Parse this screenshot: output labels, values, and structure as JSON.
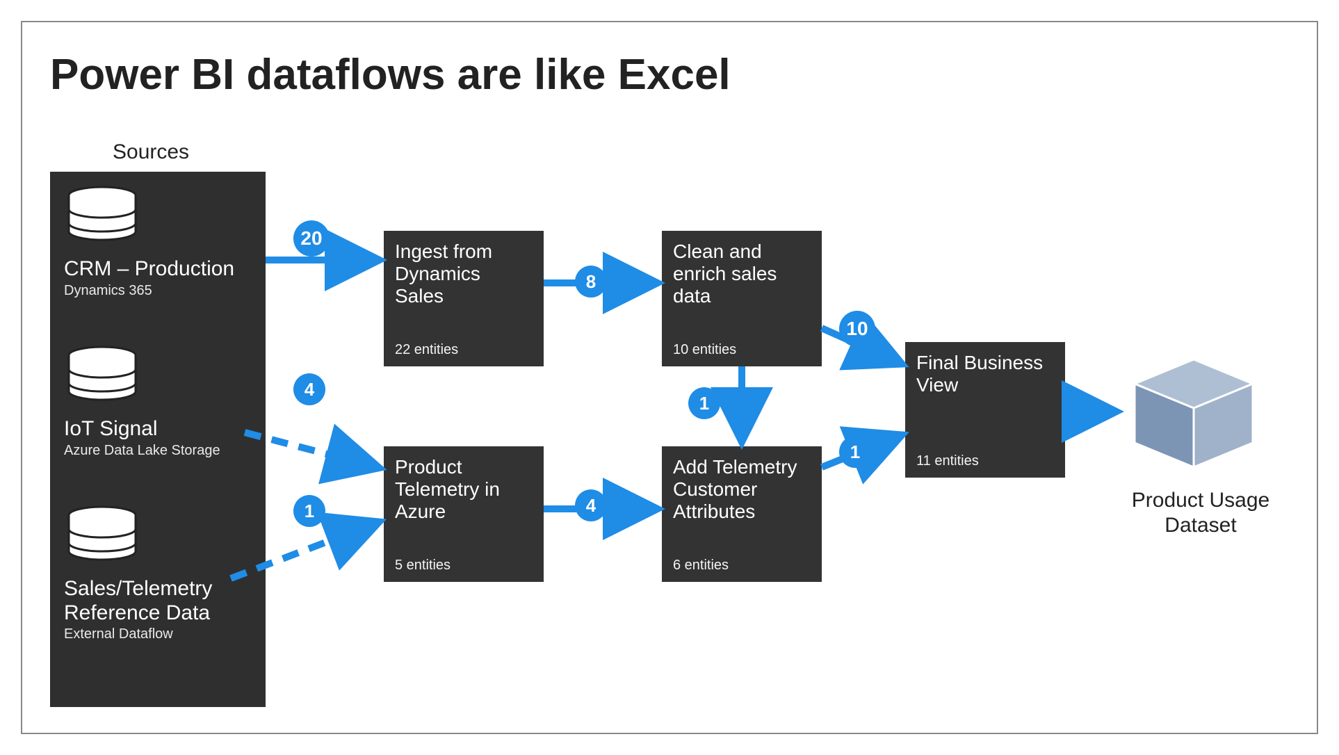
{
  "title": "Power BI dataflows are like Excel",
  "sources_label": "Sources",
  "accent": "#1f8ce6",
  "sources": [
    {
      "name": "CRM – Production",
      "sub": "Dynamics 365"
    },
    {
      "name": "IoT Signal",
      "sub": "Azure Data Lake Storage"
    },
    {
      "name": "Sales/Telemetry Reference Data",
      "sub": "External Dataflow"
    }
  ],
  "nodes": {
    "ingest": {
      "title": "Ingest from Dynamics Sales",
      "sub": "22 entities"
    },
    "clean": {
      "title": "Clean and enrich sales data",
      "sub": "10 entities"
    },
    "telem": {
      "title": "Product Telemetry in Azure",
      "sub": "5 entities"
    },
    "addattr": {
      "title": "Add Telemetry Customer Attributes",
      "sub": "6 entities"
    },
    "final": {
      "title": "Final Business View",
      "sub": "11 entities"
    }
  },
  "edges": {
    "src_crm_to_ingest": "20",
    "ingest_to_clean": "8",
    "src_iot_to_telem": "4",
    "src_ref_to_telem": "1",
    "telem_to_addattr": "4",
    "clean_to_addattr": "1",
    "clean_to_final": "10",
    "addattr_to_final": "1"
  },
  "output_label": "Product Usage Dataset"
}
